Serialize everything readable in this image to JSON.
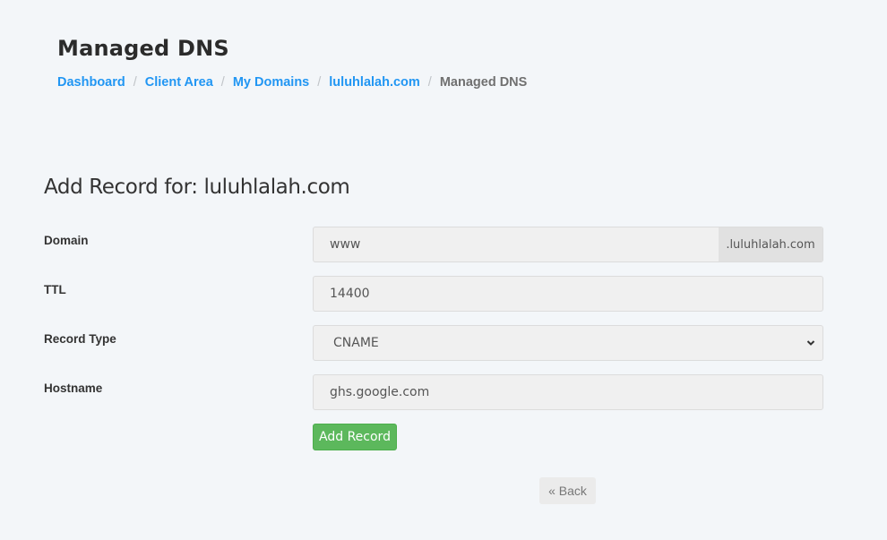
{
  "header": {
    "title": "Managed DNS",
    "breadcrumb": [
      {
        "label": "Dashboard",
        "link": true
      },
      {
        "label": "Client Area",
        "link": true
      },
      {
        "label": "My Domains",
        "link": true
      },
      {
        "label": "luluhlalah.com",
        "link": true
      },
      {
        "label": "Managed DNS",
        "link": false
      }
    ],
    "separator": "/"
  },
  "form": {
    "title": "Add Record for: luluhlalah.com",
    "domain": {
      "label": "Domain",
      "value": "www",
      "suffix": ".luluhlalah.com"
    },
    "ttl": {
      "label": "TTL",
      "value": "14400"
    },
    "record_type": {
      "label": "Record Type",
      "selected": "CNAME",
      "icon": "chevron-down-icon"
    },
    "hostname": {
      "label": "Hostname",
      "value": "ghs.google.com"
    },
    "submit_label": "Add Record",
    "submit_color": "#5cb85c"
  },
  "back_label": "« Back",
  "colors": {
    "link": "#2196f3",
    "background": "#f3f6f9"
  }
}
